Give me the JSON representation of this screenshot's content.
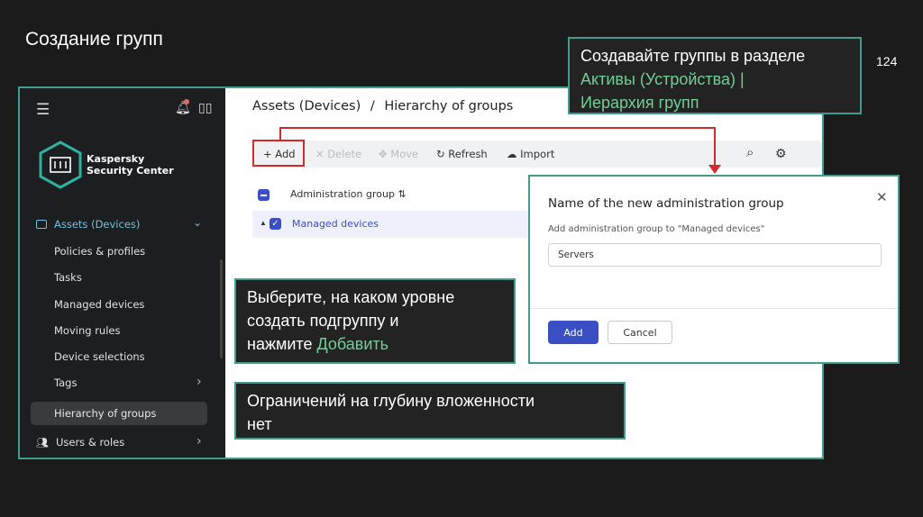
{
  "slide": {
    "title": "Создание групп",
    "page_number": "124"
  },
  "sidebar": {
    "brand_line1": "Kaspersky",
    "brand_line2": "Security Center",
    "section_label": "Assets (Devices)",
    "items": [
      {
        "label": "Policies & profiles"
      },
      {
        "label": "Tasks"
      },
      {
        "label": "Managed devices"
      },
      {
        "label": "Moving rules"
      },
      {
        "label": "Device selections"
      },
      {
        "label": "Tags"
      }
    ],
    "active_item": "Hierarchy of groups",
    "users_label": "Users & roles"
  },
  "main": {
    "breadcrumb_parent": "Assets (Devices)",
    "breadcrumb_sep": "/",
    "breadcrumb_current": "Hierarchy of groups",
    "toolbar": {
      "add": "Add",
      "delete": "Delete",
      "move": "Move",
      "refresh": "Refresh",
      "import": "Import"
    },
    "grid": {
      "column_header": "Administration group",
      "row_label": "Managed devices"
    }
  },
  "dialog": {
    "title": "Name of the new administration group",
    "subtitle": "Add administration group to \"Managed devices\"",
    "input_value": "Servers",
    "add_label": "Add",
    "cancel_label": "Cancel"
  },
  "callouts": {
    "top_line1": "Создавайте группы в разделе",
    "top_highlight1": "Активы (Устройства) |",
    "top_highlight2": "Иерархия групп",
    "mid_line1": "Выберите, на каком уровне",
    "mid_line2": "создать подгруппу и",
    "mid_line3": "нажмите",
    "mid_highlight": "Добавить",
    "bot_line1": "Ограничений на глубину вложенности",
    "bot_line2": "нет"
  },
  "colors": {
    "accent_teal": "#3f9c8f",
    "highlight_green": "#6fcf97",
    "primary_blue": "#3b4fc4",
    "marker_red": "#d22b2b"
  }
}
